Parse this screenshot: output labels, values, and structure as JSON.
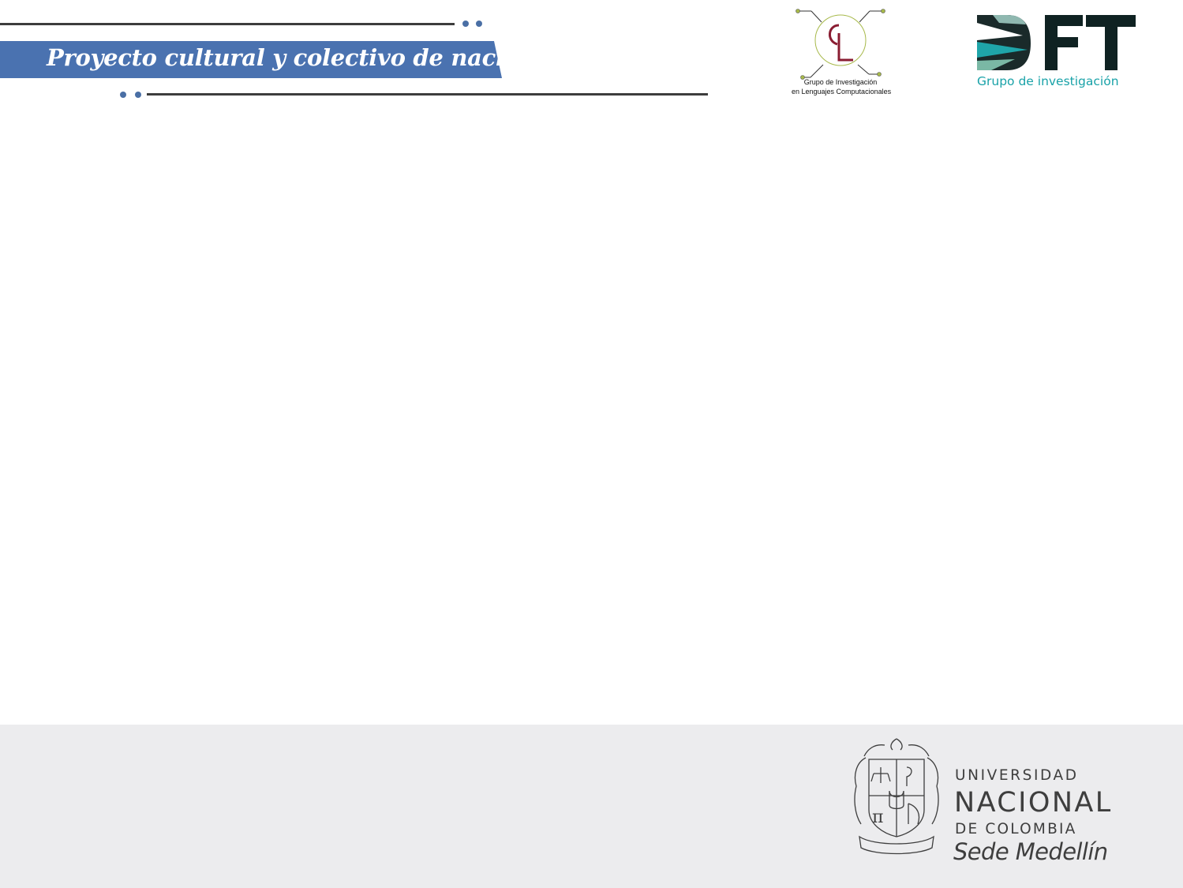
{
  "header": {
    "banner_text": "Proyecto cultural y colectivo de nación",
    "accent_color": "#4a72b0",
    "cl_logo": {
      "icon": "cl-logo-icon",
      "caption_line1": "Grupo de Investigación",
      "caption_line2": "en Lenguajes Computacionales"
    },
    "dft_logo": {
      "icon": "dft-logo-icon",
      "caption": "Grupo de investigación",
      "color": "#19a2a8"
    }
  },
  "footer": {
    "background": "#ececee",
    "crest_icon": "university-crest-icon",
    "university": {
      "line1": "UNIVERSIDAD",
      "line2": "NACIONAL",
      "line3": "DE COLOMBIA",
      "line4": "Sede Medellín"
    }
  }
}
